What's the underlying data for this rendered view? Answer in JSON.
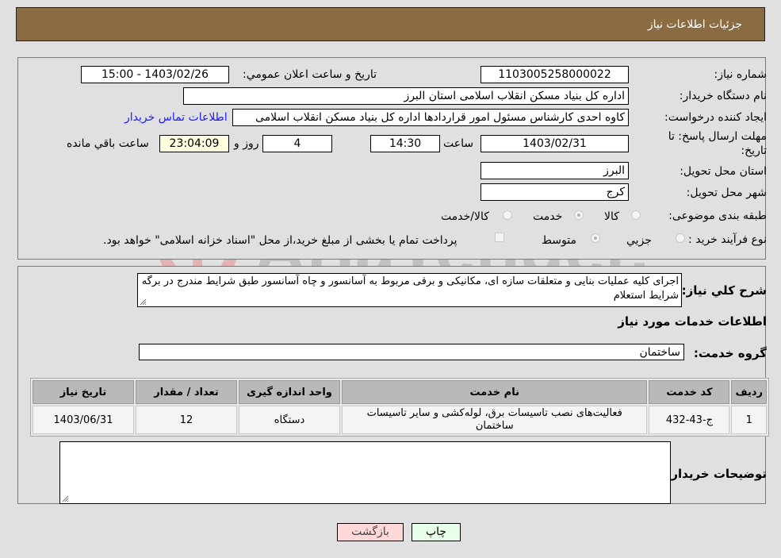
{
  "header": {
    "title": "جزئیات اطلاعات نیاز"
  },
  "form": {
    "need_number": {
      "label": "شماره نیاز:",
      "value": "1103005258000022"
    },
    "announce_datetime": {
      "label": "تاريخ و ساعت اعلان عمومي:",
      "value": "1403/02/26 - 15:00"
    },
    "buyer_org": {
      "label": "نام دستگاه خريدار:",
      "value": "اداره کل بنیاد مسکن انقلاب اسلامی استان البرز"
    },
    "requester": {
      "label": "ايجاد کننده درخواست:",
      "value": "کاوه احدی کارشناس مسئول امور قراردادها اداره کل بنیاد مسکن انقلاب اسلامی",
      "contact_link": "اطلاعات تماس خريدار"
    },
    "deadline": {
      "label_line1": "مهلت ارسال پاسخ: تا",
      "label_line2": "تاريخ:",
      "date": "1403/02/31",
      "time_label": "ساعت",
      "time": "14:30",
      "days": "4",
      "days_label": "روز و",
      "remaining": "23:04:09",
      "remaining_label": "ساعت باقي مانده"
    },
    "province": {
      "label": "استان محل تحويل:",
      "value": "البرز"
    },
    "city": {
      "label": "شهر محل تحويل:",
      "value": "کرج"
    },
    "category": {
      "label": "طبقه بندی موضوعی:",
      "options": [
        "کالا",
        "خدمت",
        "کالا/خدمت"
      ],
      "selected": "خدمت"
    },
    "purchase_type": {
      "label": "نوع فرآیند خرید :",
      "options": [
        "جزيي",
        "متوسط"
      ],
      "selected": "متوسط",
      "treasury_note": "پرداخت تمام يا بخشی از مبلغ خريد،از محل \"اسناد خزانه اسلامی\" خواهد بود."
    }
  },
  "description": {
    "label": "شرح کلي نياز:",
    "value": "اجرای کلیه عملیات بنایی و  متعلقات سازه ای، مکانیکی و برقی مربوط به آسانسور و چاه آسانسور طبق شرایط مندرج در برگه شرایط استعلام"
  },
  "services_section": {
    "title": "اطلاعات خدمات مورد نياز",
    "group_label": "گروه خدمت:",
    "group_value": "ساختمان",
    "table": {
      "headers": [
        "رديف",
        "کد خدمت",
        "نام خدمت",
        "واحد اندازه گيری",
        "تعداد / مقدار",
        "تاريخ نياز"
      ],
      "rows": [
        [
          "1",
          "ج-43-432",
          "فعالیت‌های نصب تاسیسات برق، لوله‌کشی و سایر تاسیسات ساختمان",
          "دستگاه",
          "12",
          "1403/06/31"
        ]
      ]
    }
  },
  "buyer_notes": {
    "label": "توضيحات خريدار:",
    "value": ""
  },
  "buttons": {
    "print": "چاپ",
    "back": "بازگشت"
  },
  "watermark": {
    "text": "AriaTender.neT"
  },
  "colors": {
    "header_bg": "#8b6c42",
    "print_btn_bg": "#eaffea",
    "back_btn_bg": "#ffd9d9",
    "remaining_bg": "#ffffe0",
    "link": "#1a1aff"
  }
}
